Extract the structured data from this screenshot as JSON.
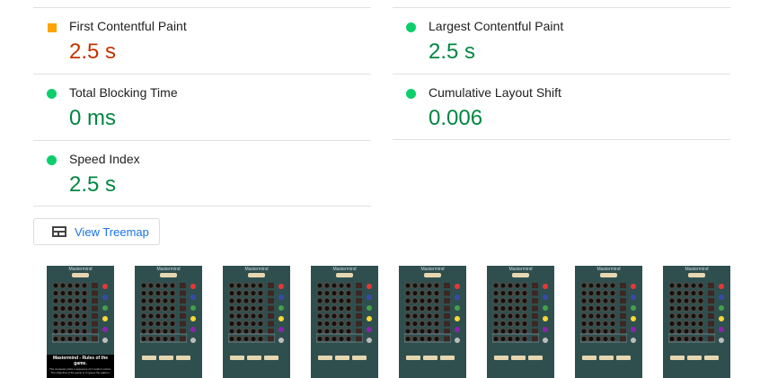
{
  "metrics": [
    {
      "label": "First Contentful Paint",
      "value": "2.5 s",
      "status": "average"
    },
    {
      "label": "Largest Contentful Paint",
      "value": "2.5 s",
      "status": "pass"
    },
    {
      "label": "Total Blocking Time",
      "value": "0 ms",
      "status": "pass"
    },
    {
      "label": "Cumulative Layout Shift",
      "value": "0.006",
      "status": "pass"
    },
    {
      "label": "Speed Index",
      "value": "2.5 s",
      "status": "pass"
    }
  ],
  "treemap_button": {
    "label": "View Treemap",
    "icon": "treemap-icon"
  },
  "filmstrip": {
    "frame_title": "Mastermind",
    "overlay_title": "Mastermind - Rules of the game.",
    "overlay_text": "The computer picks a sequence of 4 random colors. The objective of the game is to guess the pattern."
  },
  "colors": {
    "pass": "#0cce6b",
    "average": "#ffa400",
    "link": "#1a73e8",
    "frame_bg": "#2f4f4f"
  }
}
